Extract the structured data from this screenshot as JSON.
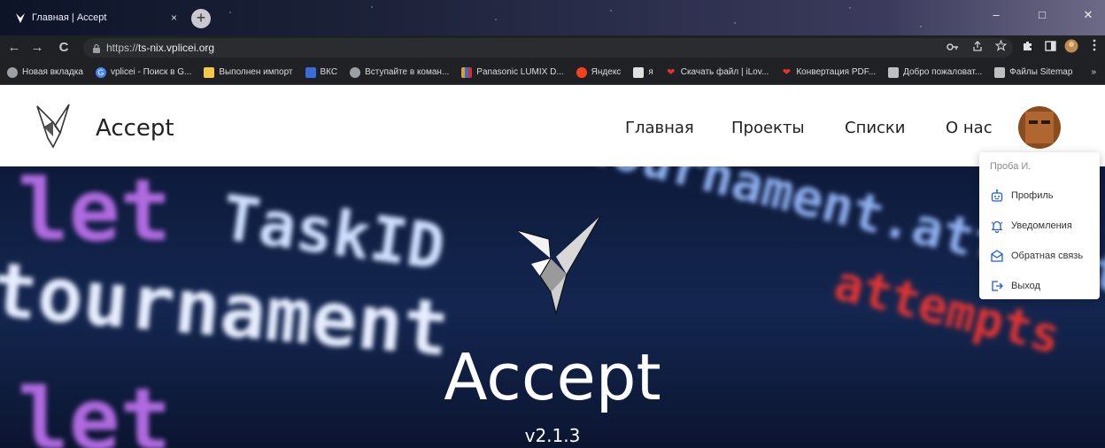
{
  "browser": {
    "tab_title": "Главная | Accept",
    "tab_close": "×",
    "new_tab": "+",
    "window_controls": {
      "minimize": "–",
      "maximize": "□",
      "close": "✕"
    },
    "nav": {
      "back": "←",
      "forward": "→",
      "reload": "C"
    },
    "url_scheme": "https://",
    "url_host": "ts-nix.vplicei.org",
    "toolbar_icons": [
      "key-icon",
      "share-icon",
      "star-icon",
      "puzzle-icon",
      "sidebar-icon",
      "profile-icon",
      "menu-icon"
    ],
    "more_bookmarks": "»",
    "bookmarks": [
      {
        "label": "Новая вкладка",
        "icon": "globe-icon",
        "color": "#9aa0a6"
      },
      {
        "label": "vplicei - Поиск в G...",
        "icon": "google-icon",
        "color": "#4285f4"
      },
      {
        "label": "Выполнен импорт",
        "icon": "folder-icon",
        "color": "#f2c94c"
      },
      {
        "label": "ВКС",
        "icon": "vks-icon",
        "color": "#3b6bd6"
      },
      {
        "label": "Вступайте в коман...",
        "icon": "globe-icon",
        "color": "#9aa0a6"
      },
      {
        "label": "Panasonic LUMIX D...",
        "icon": "panasonic-icon",
        "color": "#e0a030"
      },
      {
        "label": "Яндекс",
        "icon": "yandex-icon",
        "color": "#fc3f1d"
      },
      {
        "label": "я",
        "icon": "page-icon",
        "color": "#e0e0e0"
      },
      {
        "label": "Скачать файл | iLov...",
        "icon": "heart-icon",
        "color": "#e5322d"
      },
      {
        "label": "Конвертация PDF...",
        "icon": "heart-icon",
        "color": "#e5322d"
      },
      {
        "label": "Добро пожаловат...",
        "icon": "drive-icon",
        "color": "#c0c0c0"
      },
      {
        "label": "Файлы Sitemap",
        "icon": "drive-icon",
        "color": "#c0c0c0"
      }
    ]
  },
  "header": {
    "brand": "Accept",
    "nav": [
      {
        "label": "Главная"
      },
      {
        "label": "Проекты"
      },
      {
        "label": "Списки"
      },
      {
        "label": "О нас"
      }
    ]
  },
  "hero": {
    "title": "Accept",
    "version": "v2.1.3",
    "code_lines": [
      {
        "text": "let",
        "color": "#b06ae0"
      },
      {
        "text": "TaskID",
        "color": "#cfe0ff"
      },
      {
        "text": "tournament",
        "color": "#e6eeff"
      },
      {
        "text": "= tournament.attempts",
        "color": "#8fb0f0"
      },
      {
        "text": "attempts",
        "color": "#e03434"
      }
    ]
  },
  "dropdown": {
    "user": "Проба И.",
    "items": [
      {
        "label": "Профиль",
        "icon": "robot-icon"
      },
      {
        "label": "Уведомления",
        "icon": "bell-icon"
      },
      {
        "label": "Обратная связь",
        "icon": "mail-icon"
      },
      {
        "label": "Выход",
        "icon": "logout-icon"
      }
    ]
  },
  "colors": {
    "accent": "#1e5bd6",
    "hero_bg": "#0d1a3a"
  }
}
